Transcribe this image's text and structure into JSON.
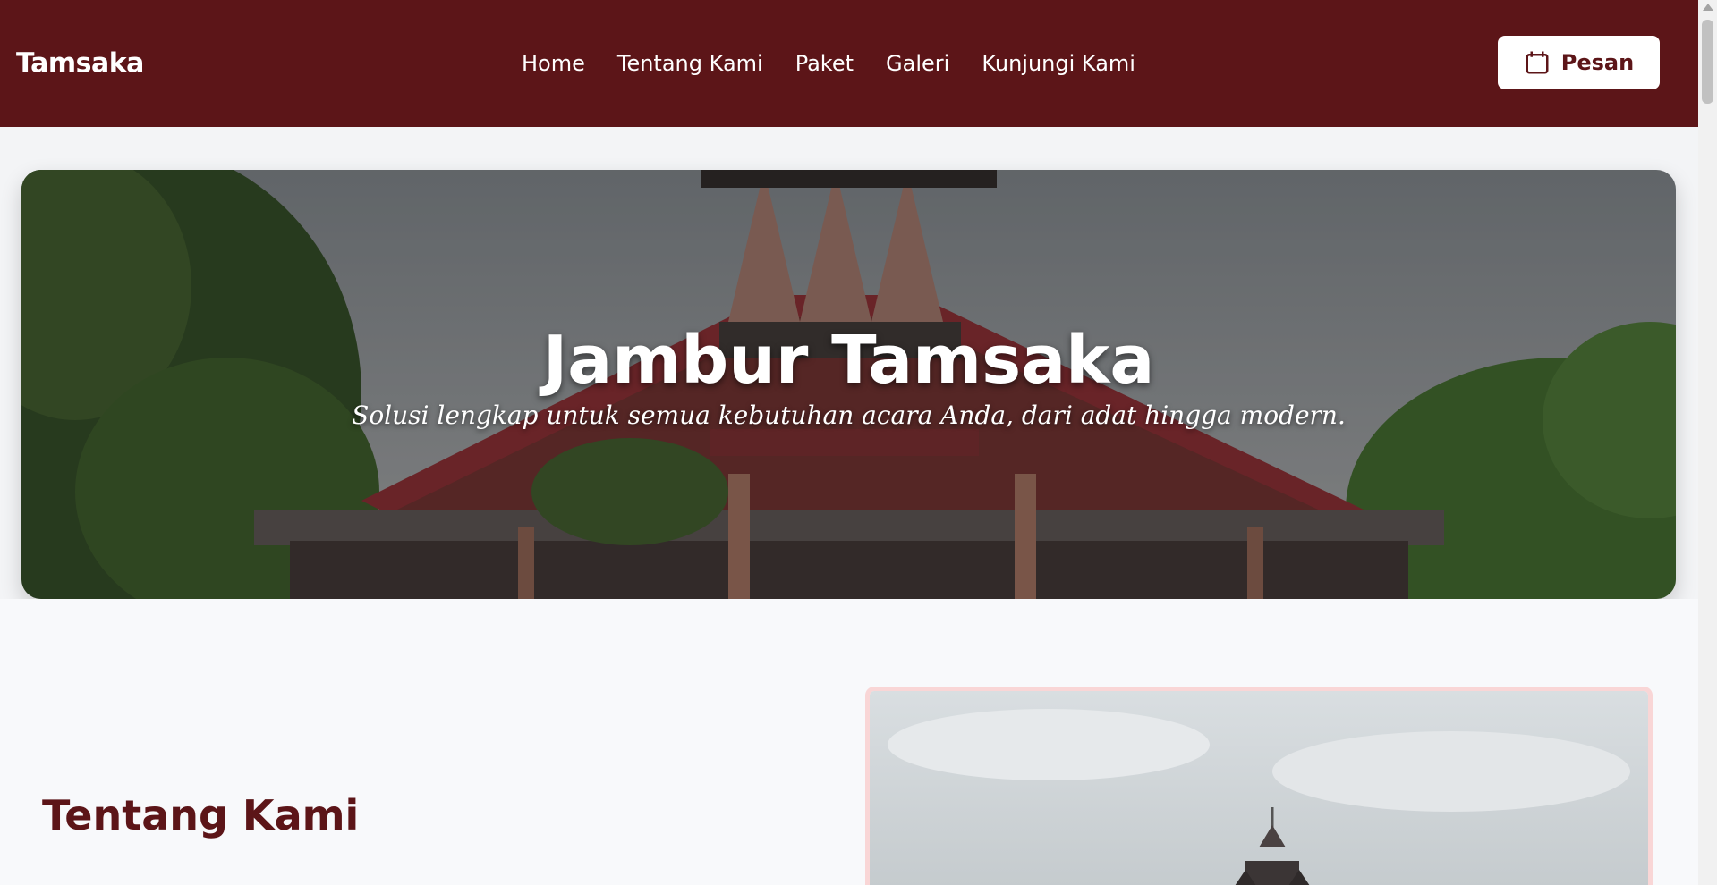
{
  "navbar": {
    "brand": "Tamsaka",
    "links": [
      "Home",
      "Tentang Kami",
      "Paket",
      "Galeri",
      "Kunjungi Kami"
    ],
    "order_label": "Pesan",
    "order_icon": "calendar-icon"
  },
  "hero": {
    "title": "Jambur Tamsaka",
    "subtitle": "Solusi lengkap untuk semua kebutuhan acara Anda, dari adat hingga modern."
  },
  "about": {
    "title": "Tentang Kami"
  },
  "colors": {
    "brand": "#5c1518",
    "page_bg": "#f3f4f6",
    "image_border": "#f9d6d6"
  }
}
